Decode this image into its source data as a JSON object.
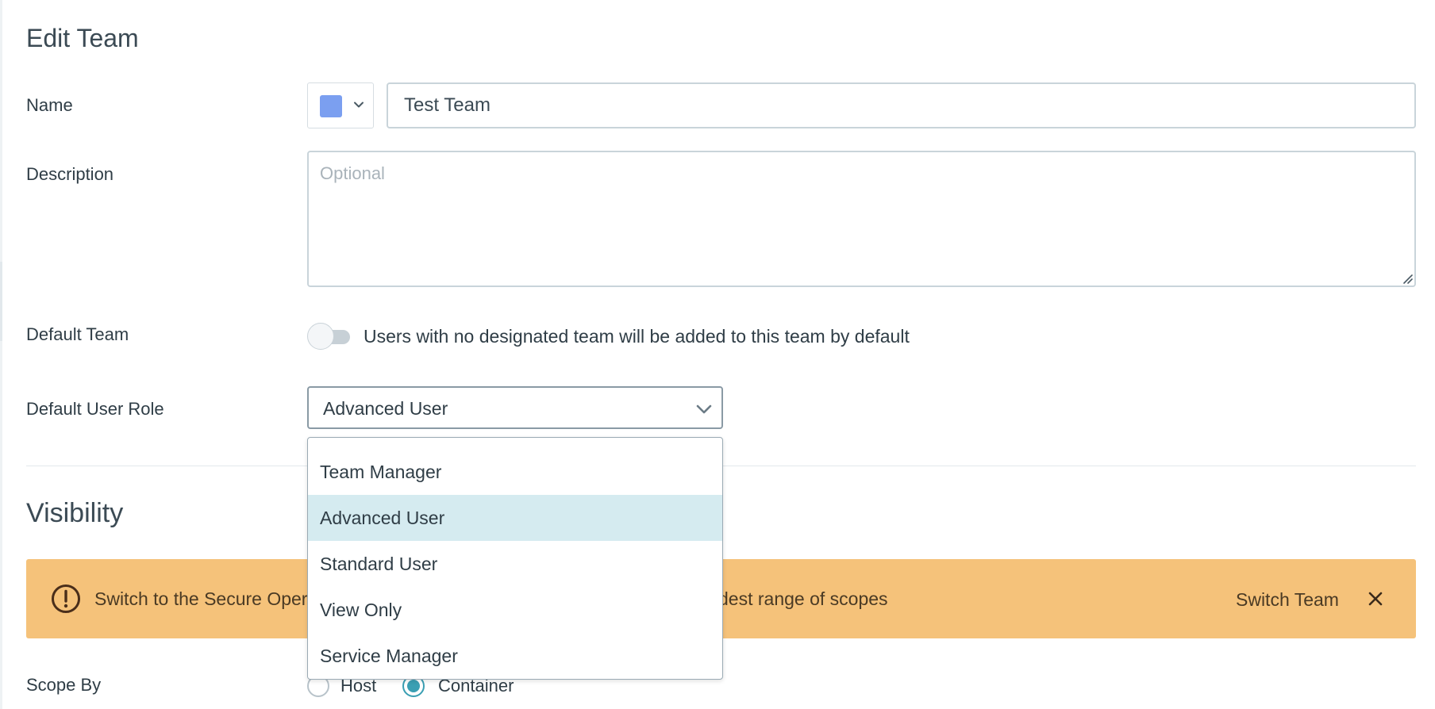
{
  "page": {
    "title": "Edit Team"
  },
  "form": {
    "name_label": "Name",
    "color": "#7b9ff0",
    "name_value": "Test Team",
    "description_label": "Description",
    "description_placeholder": "Optional",
    "default_team_label": "Default Team",
    "default_team_toggle": false,
    "default_team_text": "Users with no designated team will be added to this team by default",
    "default_role_label": "Default User Role",
    "default_role_value": "Advanced User"
  },
  "role_dropdown": {
    "open": true,
    "options": [
      "Team Manager",
      "Advanced User",
      "Standard User",
      "View Only",
      "Service Manager"
    ],
    "selected": "Advanced User"
  },
  "visibility": {
    "title": "Visibility",
    "alert_text_left": "Switch to the Secure Opera",
    "alert_text_right": "dest range of scopes",
    "alert_action": "Switch Team",
    "alert_color": "#f5c27a",
    "scope_label": "Scope By",
    "scope_options": [
      "Host",
      "Container"
    ],
    "scope_selected": "Container"
  },
  "colors": {
    "accent": "#3a9fb3",
    "selected_option_bg": "#d5ebf0"
  }
}
